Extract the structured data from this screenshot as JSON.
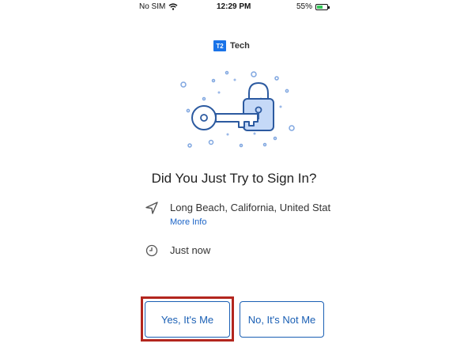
{
  "status_bar": {
    "carrier": "No SIM",
    "time": "12:29 PM",
    "battery_percent": "55%",
    "battery_level": 0.55
  },
  "brand": {
    "logo_text": "T2",
    "name": "Tech"
  },
  "prompt": {
    "title": "Did You Just Try to Sign In?",
    "location": "Long Beach, California, United Stat",
    "more_info_link": "More Info",
    "time_text": "Just now"
  },
  "actions": {
    "confirm_label": "Yes, It's Me",
    "deny_label": "No, It's Not Me"
  },
  "icons": {
    "wifi": "wifi-icon",
    "battery": "battery-charging-icon",
    "location": "location-arrow-icon",
    "clock": "clock-icon",
    "illustration": "key-and-padlock-illustration"
  },
  "colors": {
    "accent": "#1a5fb4",
    "brand": "#1a73e8",
    "highlight": "#b3261e",
    "illustration_fill": "#c5d9f7"
  }
}
